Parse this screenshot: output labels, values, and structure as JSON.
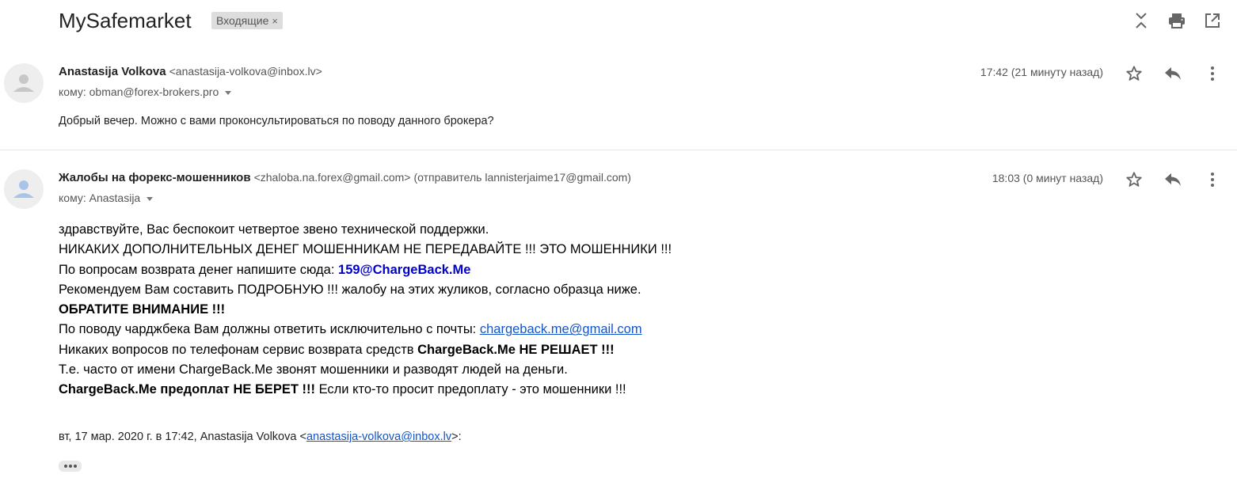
{
  "thread": {
    "subject": "MySafemarket",
    "label": "Входящие",
    "label_remove": "×"
  },
  "header_icons": [
    "collapse-all-icon",
    "print-icon",
    "open-new-window-icon"
  ],
  "messages": [
    {
      "sender_name": "Anastasija Volkova",
      "sender_email": "<anastasija-volkova@inbox.lv>",
      "to": "кому: obman@forex-brokers.pro",
      "time": "17:42 (21 минуту назад)",
      "body": "Добрый вечер. Можно с вами проконсультироваться по поводу данного брокера?"
    },
    {
      "sender_name": "Жалобы на форекс-мошенников",
      "sender_email": "<zhaloba.na.forex@gmail.com>",
      "sender_extra": "(отправитель lannisterjaime17@gmail.com)",
      "to": "кому: Anastasija",
      "time": "18:03 (0 минут назад)",
      "body_lines": {
        "l1": "здравствуйте, Вас беспокоит четвертое звено технической поддержки.",
        "l2": "НИКАКИХ ДОПОЛНИТЕЛЬНЫХ ДЕНЕГ МОШЕННИКАМ НЕ ПЕРЕДАВАЙТЕ !!! ЭТО МОШЕННИКИ !!!",
        "l3_text": "По вопросам возврата денег напишите сюда: ",
        "l3_bold": "159@ChargeBack.Me",
        "l4": "Рекомендуем Вам составить ПОДРОБНУЮ !!! жалобу на этих жуликов, согласно образца ниже.",
        "l5": "ОБРАТИТЕ ВНИМАНИЕ !!!",
        "l6_text": "По поводу чарджбека Вам должны ответить исключительно с почты: ",
        "l6_link": "chargeback.me@gmail.com",
        "l7_text": "Никаких вопросов по телефонам сервис возврата средств ",
        "l7_bold": "ChargeBack.Me НЕ РЕШАЕТ !!!",
        "l8": "Т.е. часто от имени ChargeBack.Me звонят мошенники и разводят людей на деньги.",
        "l9_bold": "ChargeBack.Me предоплат НЕ БЕРЕТ !!!",
        "l9_text": " Если кто-то просит предоплату - это мошенники !!!"
      },
      "quote_prefix": "вт, 17 мар. 2020 г. в 17:42, Anastasija Volkova <",
      "quote_link": "anastasija-volkova@inbox.lv",
      "quote_suffix": ">:"
    }
  ],
  "message_icons": [
    "star-icon",
    "reply-icon",
    "more-options-icon"
  ],
  "colors": {
    "link": "#1155cc",
    "bold_link": "#0000cc",
    "label_bg": "#dddddd"
  }
}
